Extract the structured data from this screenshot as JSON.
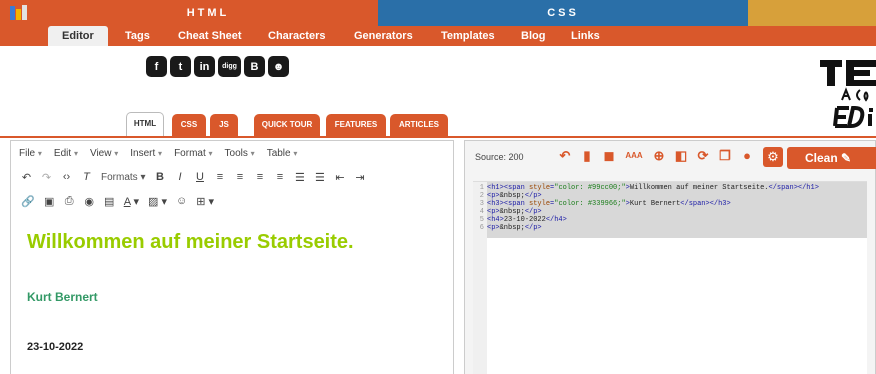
{
  "topbar": {
    "html_label": "HTML",
    "css_label": "CSS"
  },
  "nav": {
    "items": [
      "Editor",
      "Tags",
      "Cheat Sheet",
      "Characters",
      "Generators",
      "Templates",
      "Blog",
      "Links"
    ],
    "active": "Editor"
  },
  "social": {
    "icons": [
      "facebook-icon",
      "twitter-icon",
      "linkedin-icon",
      "digg-icon",
      "blogger-icon",
      "reddit-icon"
    ],
    "digg_text": "digg"
  },
  "lang_tabs": [
    "HTML",
    "CSS",
    "JS",
    "QUICK TOUR",
    "FEATURES",
    "ARTICLES"
  ],
  "editor": {
    "menu": [
      "File",
      "Edit",
      "View",
      "Insert",
      "Format",
      "Tools",
      "Table"
    ],
    "formats_label": "Formats",
    "h1": "Willkommen auf meiner Startseite.",
    "h3": "Kurt Bernert",
    "h4": "23-10-2022"
  },
  "source": {
    "label": "Source: 200",
    "clean_label": "Clean",
    "lines": [
      "<h1><span style=\"color: #99cc00;\">Willkommen auf meiner Startseite.</span></h1>",
      "<p>&nbsp;</p>",
      "<h3><span style=\"color: #339966;\">Kurt Bernert</span></h3>",
      "<p>&nbsp;</p>",
      "<h4>23-10-2022</h4>",
      "<p>&nbsp;</p>"
    ]
  },
  "colors": {
    "accent": "#d9582b",
    "css_blue": "#2a6fa8",
    "js_gold": "#d7a03a",
    "h1_green": "#99cc00",
    "h3_green": "#339966"
  }
}
